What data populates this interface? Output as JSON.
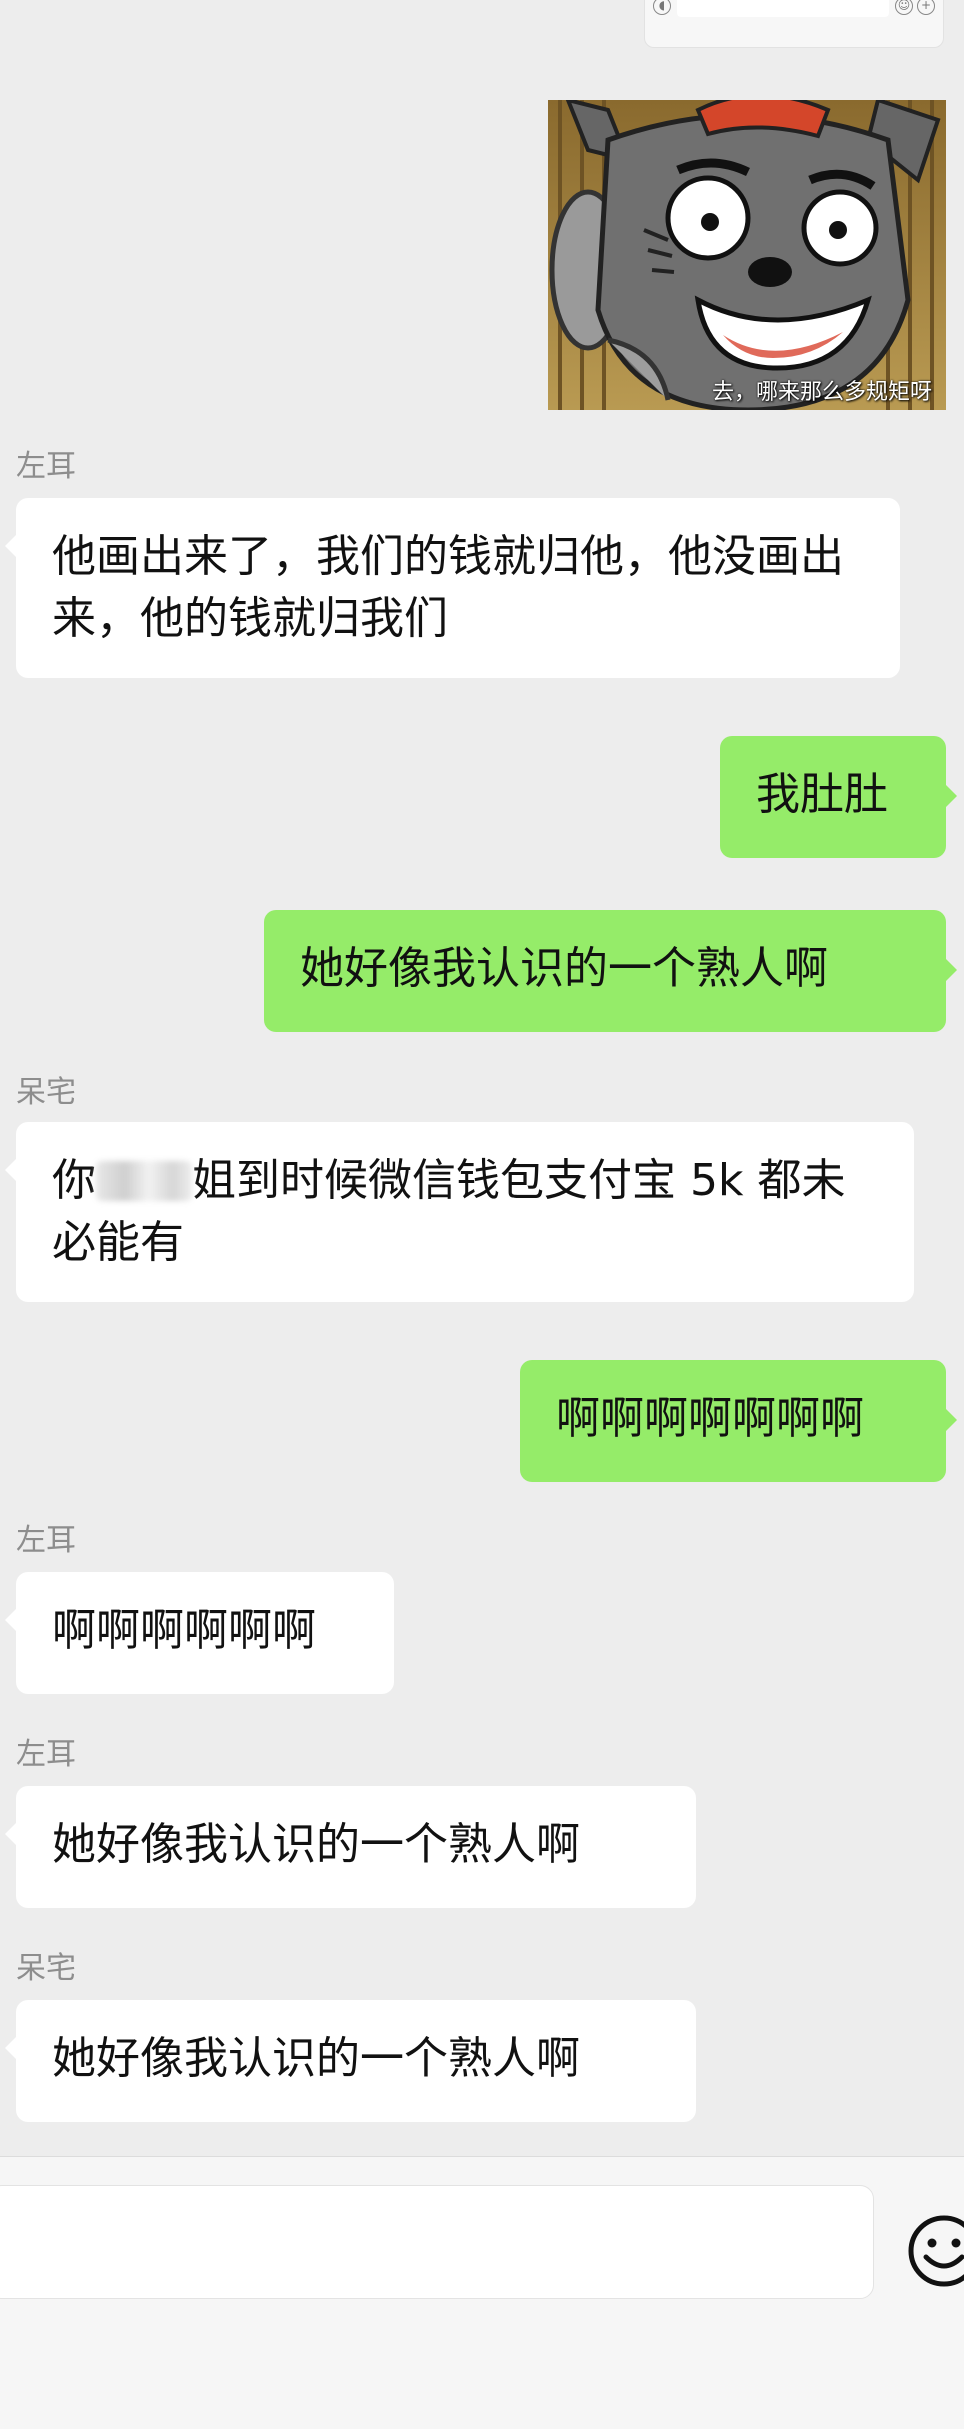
{
  "sticker": {
    "caption": "去，哪来那么多规矩呀"
  },
  "messages": [
    {
      "sender": "左耳",
      "text": "他画出来了，我们的钱就归他，他没画出来，他的钱就归我们"
    },
    {
      "sender": "",
      "text": "我肚肚"
    },
    {
      "sender": "",
      "text": "她好像我认识的一个熟人啊"
    },
    {
      "sender": "呆宅",
      "text_before": "你",
      "text_after": "姐到时候微信钱包支付宝 5k 都未必能有"
    },
    {
      "sender": "",
      "text": "啊啊啊啊啊啊啊"
    },
    {
      "sender": "左耳",
      "text": "啊啊啊啊啊啊"
    },
    {
      "sender": "左耳",
      "text": "她好像我认识的一个熟人啊"
    },
    {
      "sender": "呆宅",
      "text": "她好像我认识的一个熟人啊"
    }
  ],
  "colors": {
    "background": "#ededed",
    "outgoing_bubble": "#95ec69",
    "incoming_bubble": "#ffffff",
    "sender_name": "#8d8d8d"
  },
  "icons": {
    "emoji": "smiley-face-icon",
    "voice": "voice-icon",
    "add": "plus-icon"
  }
}
